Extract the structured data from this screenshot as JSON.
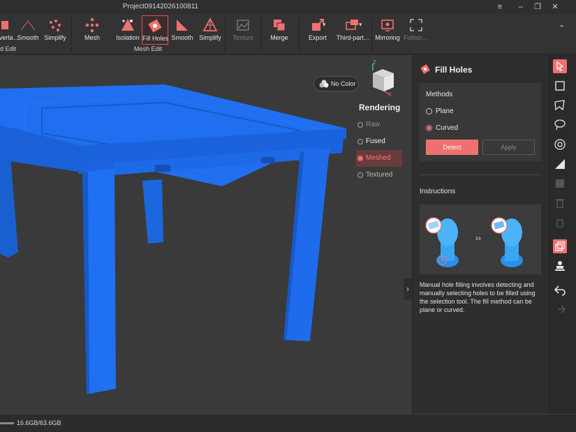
{
  "titlebar": {
    "title": "Project09142026100811"
  },
  "toolbar": {
    "groups": [
      {
        "label": "d Edit",
        "tools": [
          "Overla…",
          "Smooth",
          "Simplify"
        ]
      },
      {
        "label": "Mesh Edit",
        "tools": [
          "Mesh",
          "Isolation",
          "Fill Holes",
          "Smooth",
          "Simplify"
        ]
      },
      {
        "label": "",
        "tools": [
          "Texture",
          "Merge"
        ]
      },
      {
        "label": "",
        "tools": [
          "Export",
          "Third-part…"
        ]
      },
      {
        "label": "",
        "tools": [
          "Mirroring",
          "Fullscr…"
        ]
      }
    ]
  },
  "viewport": {
    "color_toggle": "No Color",
    "rendering": {
      "title": "Rendering",
      "options": [
        "Raw",
        "Fused",
        "Meshed",
        "Textured"
      ],
      "selected": "Meshed"
    },
    "axis_labels": {
      "z": "Z",
      "x": "X"
    },
    "model_color": "#1e6ff0"
  },
  "panel": {
    "title": "Fill Holes",
    "methods": {
      "title": "Methods",
      "options": [
        "Plane",
        "Curved"
      ],
      "selected": "Curved"
    },
    "buttons": {
      "detect": "Detect",
      "apply": "Apply"
    },
    "instructions_title": "Instructions",
    "instructions_text": "Manual hole filling involves detecting and manually selecting holes to be filled using the selection tool. The fill method can be plane or curved."
  },
  "statusbar": {
    "memory": "16.6GB/63.6GB"
  },
  "colors": {
    "accent": "#f07070",
    "model": "#1e6ff0"
  }
}
